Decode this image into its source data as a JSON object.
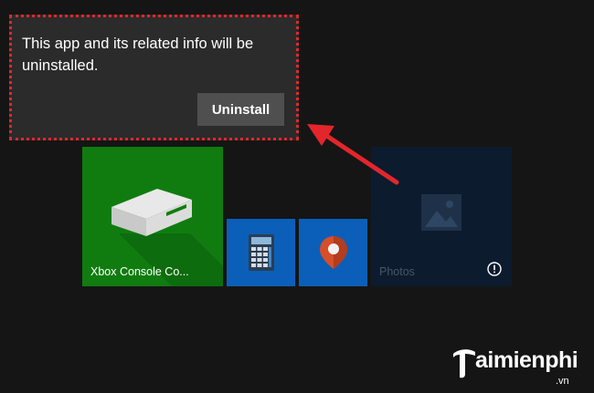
{
  "flyout": {
    "message": "This app and its related info will be uninstalled.",
    "uninstall_label": "Uninstall"
  },
  "tiles": {
    "xbox": {
      "label": "Xbox Console Co...",
      "icon": "xbox-console-icon",
      "color": "#107c10"
    },
    "calculator": {
      "icon": "calculator-icon",
      "color": "#0b5fb8"
    },
    "maps": {
      "icon": "map-pin-icon",
      "color": "#0b5fb8"
    },
    "photos": {
      "label": "Photos",
      "icon": "photos-icon",
      "badge_icon": "info-icon",
      "color": "#0c1b2e"
    }
  },
  "annotation": {
    "outline_color": "#e3262b",
    "arrow_color": "#e3262b"
  },
  "watermark": {
    "text": "aimienphi",
    "tld": ".vn"
  }
}
